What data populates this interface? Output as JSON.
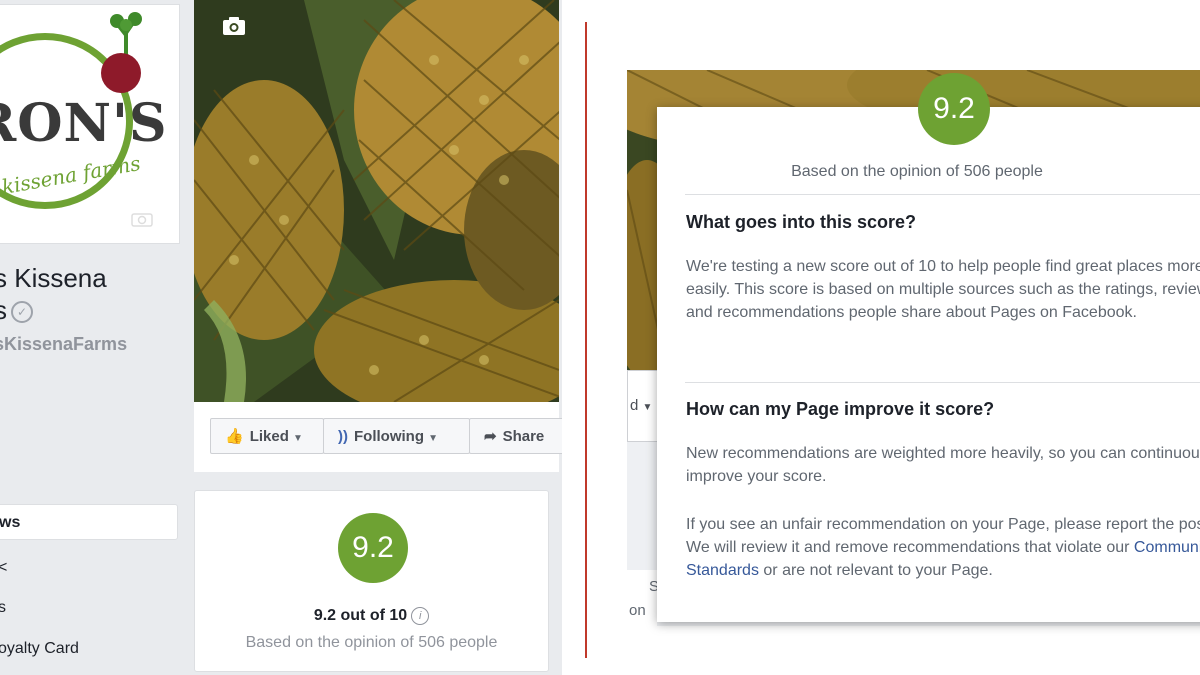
{
  "left_panel": {
    "logo": {
      "main_text": "RON'S",
      "sub_text": "kissena farms"
    },
    "page_name_line1": "s Kissena",
    "page_name_line2": "s",
    "handle": "sKissenaFarms",
    "nav": [
      {
        "label": "ws",
        "active": true
      },
      {
        "label": "<",
        "active": false
      },
      {
        "label": "s",
        "active": false
      },
      {
        "label": "oyalty Card",
        "active": false
      }
    ],
    "actions": {
      "liked": "Liked",
      "following": "Following",
      "share": "Share"
    },
    "score_card": {
      "score": "9.2",
      "score_text": "9.2 out of 10",
      "info_icon": "i",
      "based_on": "Based on the opinion of 506 people"
    }
  },
  "right_panel": {
    "bg_fragments": {
      "dropdown": "d",
      "label_a": "S",
      "label_b": "on"
    },
    "dialog": {
      "score": "9.2",
      "based_on": "Based on the opinion of 506 people",
      "section1_title": "What goes into this score?",
      "section1_text": "We're testing a new score out of 10 to help people find great places more easily. This score is based on multiple sources such as the ratings, reviews and recommendations people share about Pages on Facebook.",
      "section2_title": "How can my Page improve it score?",
      "section2_text": "New recommendations are weighted more heavily, so you can continuously improve your score.",
      "section3_text_before": "If you see an unfair recommendation on your Page, please report the post. We will review it and remove recommendations that violate our",
      "section3_link": "Community Standards",
      "section3_text_after": "or are not relevant to your Page."
    }
  },
  "colors": {
    "score_green": "#6ea233",
    "fb_blue": "#4267b2",
    "link_blue": "#365899",
    "divider_red": "#c0392b"
  }
}
